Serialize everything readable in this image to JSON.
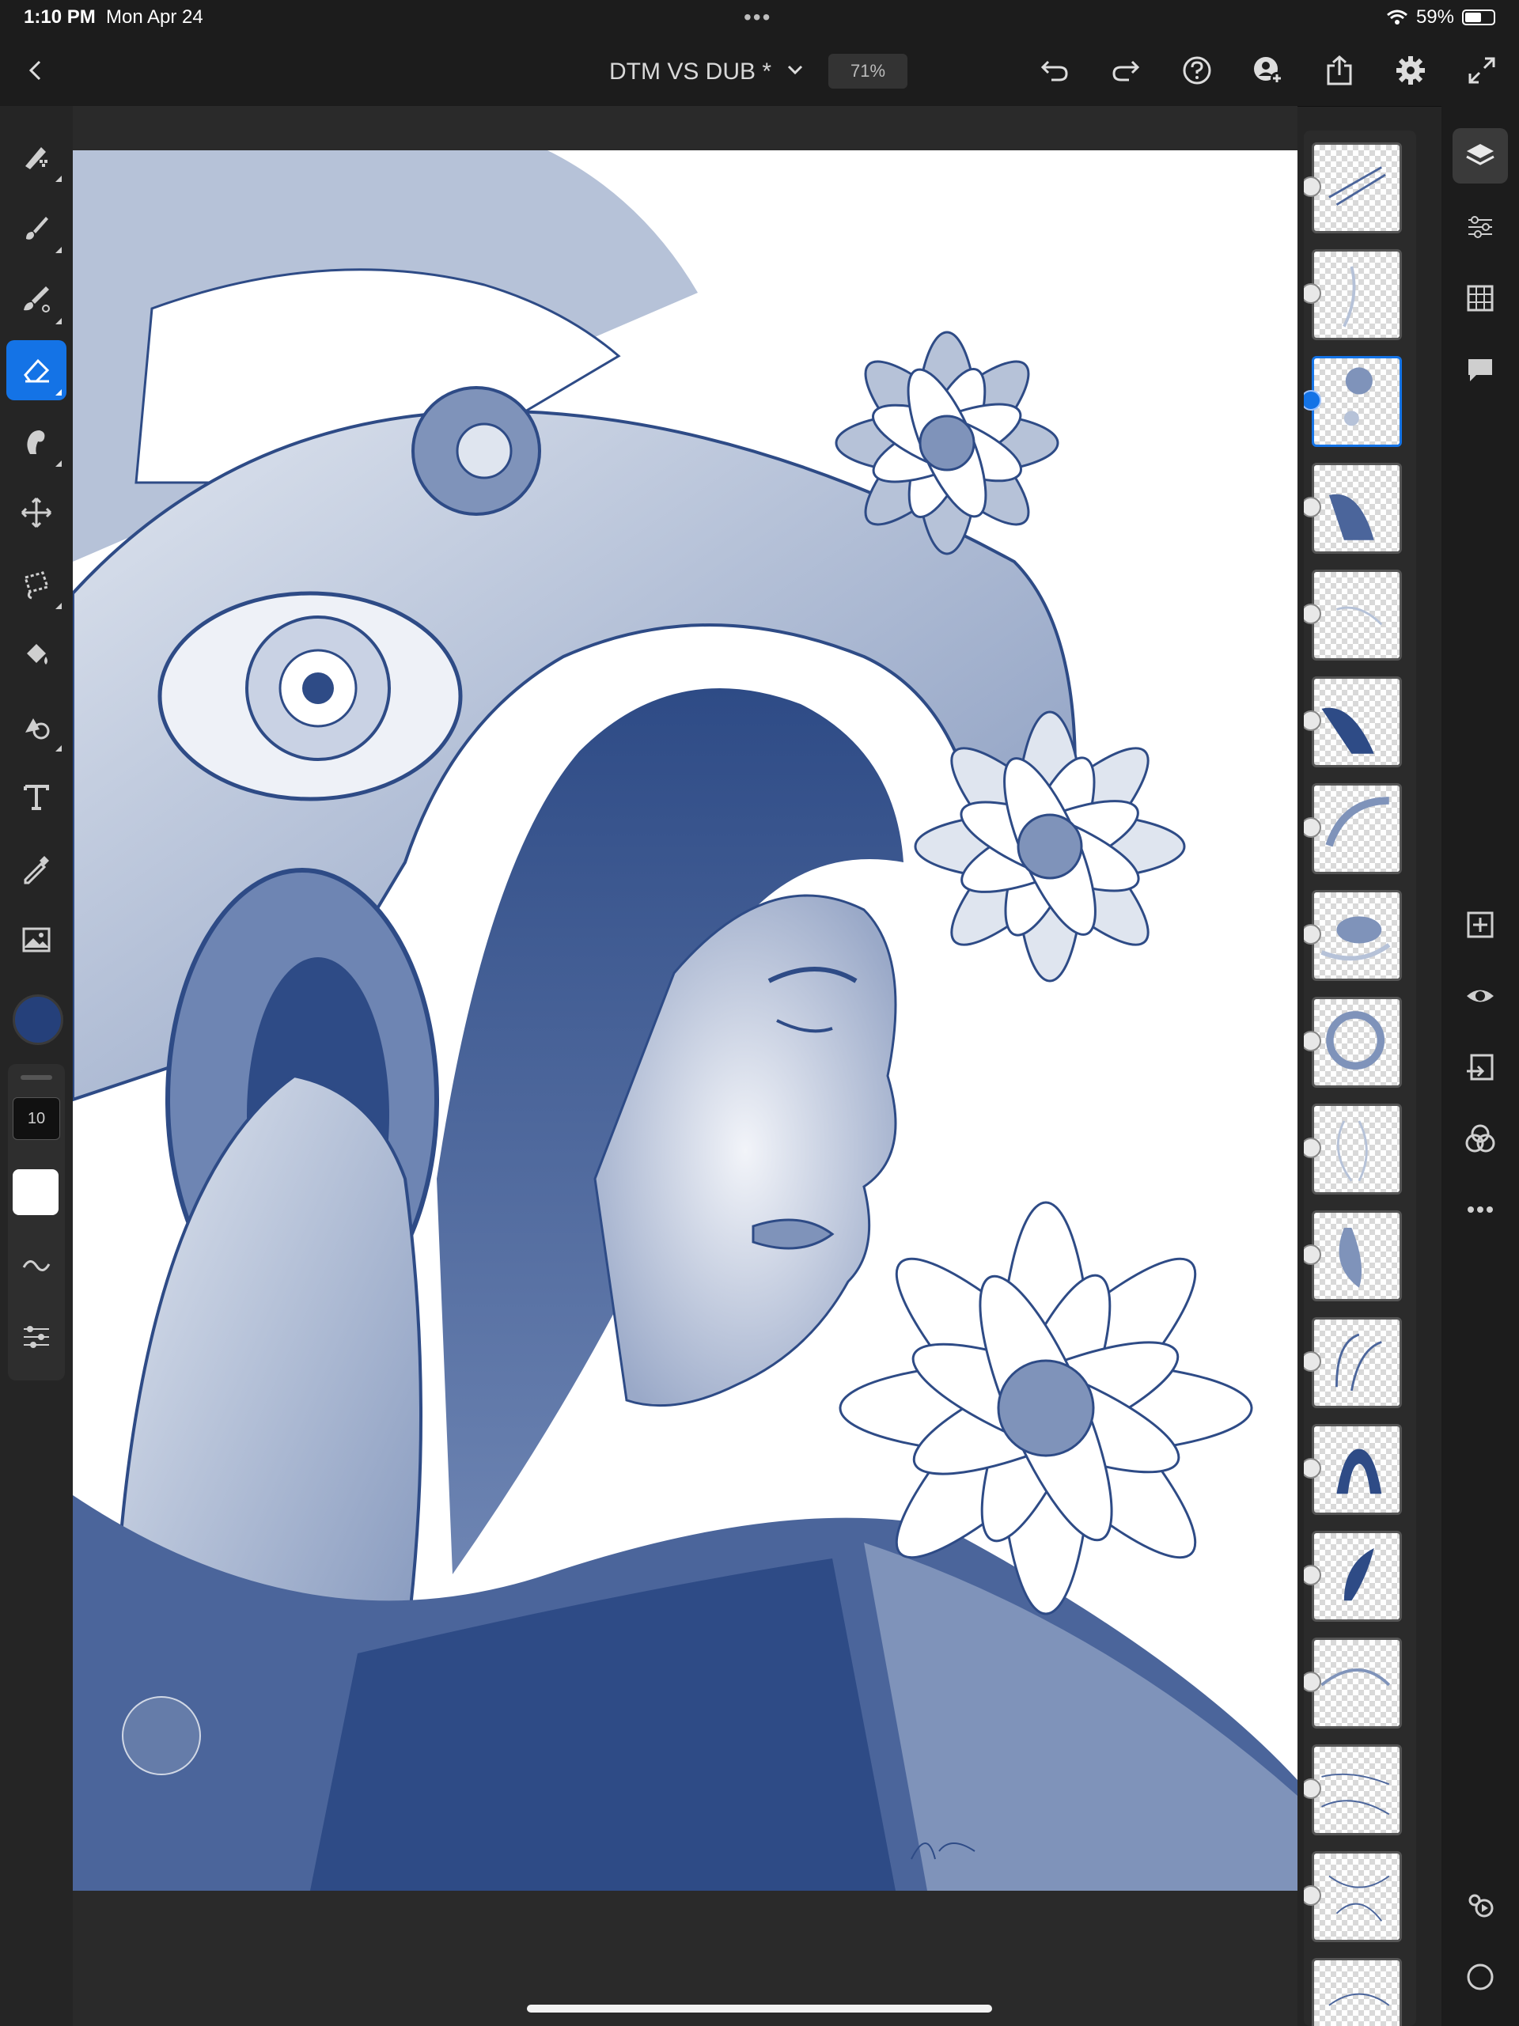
{
  "status_bar": {
    "time": "1:10 PM",
    "date": "Mon Apr 24",
    "battery": "59%",
    "battery_level": 0.59
  },
  "top_bar": {
    "document_title": "DTM VS DUB *",
    "zoom": "71%",
    "buttons": [
      "back-icon",
      "undo-icon",
      "redo-icon",
      "help-icon",
      "invite-icon",
      "share-icon",
      "settings-icon",
      "fullscreen-icon"
    ]
  },
  "tools": {
    "items": [
      "pixel-brush-icon",
      "live-brush-icon",
      "vector-brush-icon",
      "eraser-icon",
      "smudge-icon",
      "move-icon",
      "lasso-select-icon",
      "fill-icon",
      "shape-icon",
      "text-icon",
      "eyedropper-icon",
      "image-icon"
    ],
    "active": "eraser-icon",
    "current_color": "#25407a",
    "brush_size": "10"
  },
  "layers": {
    "count": 18,
    "selected_index": 2
  },
  "right_bar": [
    "layers-icon",
    "layer-properties-icon",
    "grid-icon",
    "comments-icon",
    "add-layer-icon",
    "visibility-icon",
    "import-icon",
    "blend-icon",
    "more-icon",
    "timelapse-icon",
    "circle-icon"
  ],
  "colors": {
    "accent": "#1473e6",
    "ink": "#2e4b86",
    "ink_light": "#b6c2d8",
    "background": "#252525"
  }
}
